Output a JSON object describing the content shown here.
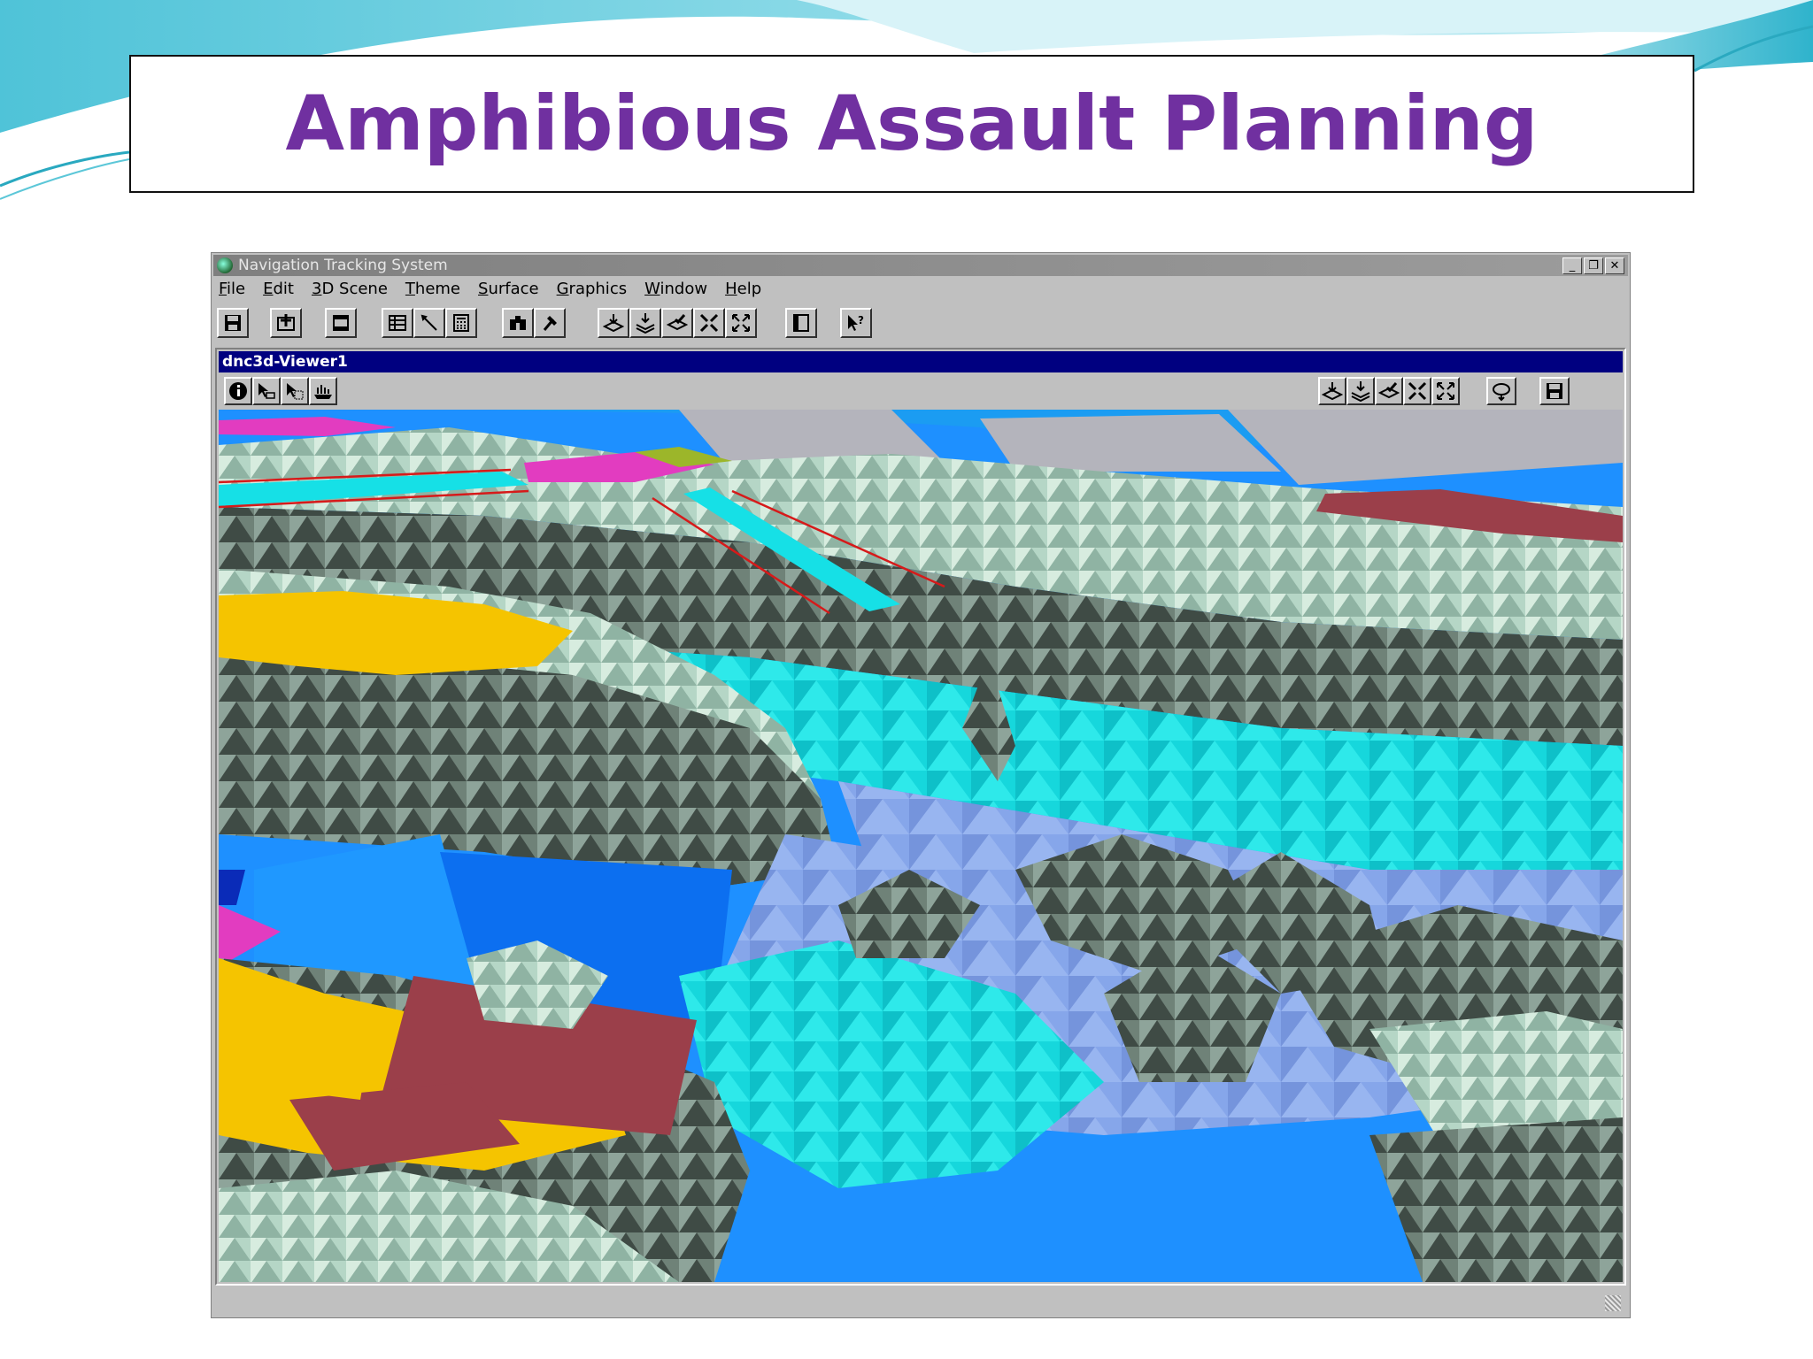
{
  "slide": {
    "title": "Amphibious Assault Planning"
  },
  "window": {
    "title": "Navigation Tracking System",
    "controls": {
      "minimize": "_",
      "restore": "❐",
      "close": "✕"
    },
    "menu": [
      "File",
      "Edit",
      "3D Scene",
      "Theme",
      "Surface",
      "Graphics",
      "Window",
      "Help"
    ]
  },
  "viewer": {
    "title": "dnc3d-Viewer1"
  },
  "colors": {
    "title_purple": "#7030a0",
    "ocean_blue": "#1e90ff",
    "shallow_cyan": "#00e5e5",
    "terrain_gray": "#5c6b63",
    "zone_yellow": "#f5c400",
    "zone_maroon": "#9b3f4a",
    "zone_magenta": "#e23cc0"
  },
  "icons": {
    "main_toolbar": [
      "save-icon",
      "add-theme-icon",
      "window-icon",
      "table-icon",
      "edit-icon",
      "calculator-icon",
      "binoculars-icon",
      "hammer-icon",
      "layer-down-icon",
      "layers-down-icon",
      "layer-check-icon",
      "zoom-in-icon",
      "zoom-extent-icon",
      "panel-icon",
      "help-pointer-icon"
    ],
    "viewer_left": [
      "info-icon",
      "select-icon",
      "select-graphic-icon",
      "ship-icon"
    ],
    "viewer_right": [
      "layer-down-icon",
      "layers-down-icon",
      "layer-check-icon",
      "zoom-in-icon",
      "zoom-extent-icon",
      "navigate-icon",
      "save-icon"
    ]
  }
}
